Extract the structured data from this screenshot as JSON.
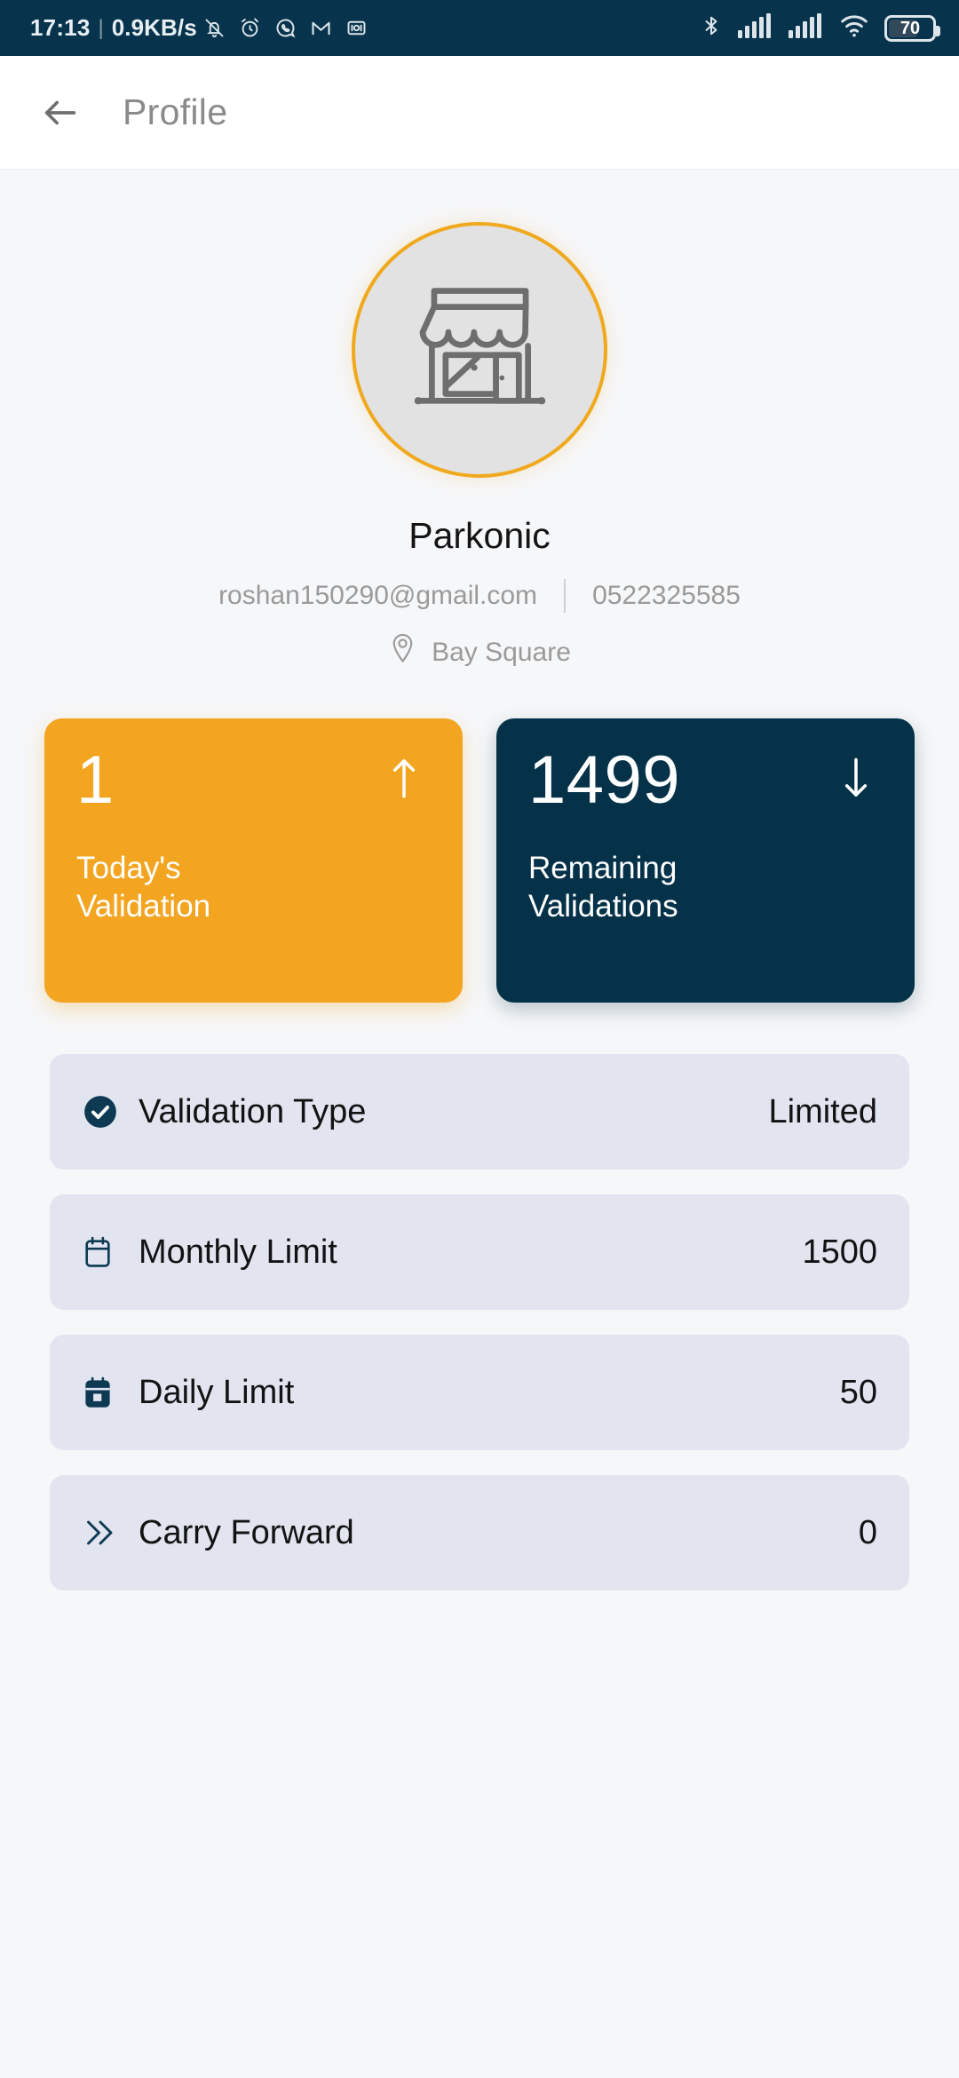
{
  "status_bar": {
    "time": "17:13",
    "separator": "|",
    "network_speed": "0.9KB/s",
    "left_icons": [
      "mute-bell-icon",
      "alarm-clock-icon",
      "whatsapp-icon",
      "gmail-icon",
      "screen-record-icon"
    ],
    "right_icons": [
      "bluetooth-icon",
      "signal-sim1-icon",
      "signal-sim2-icon",
      "wifi-icon"
    ],
    "battery_level": "70",
    "background_color": "#07344c"
  },
  "app_bar": {
    "back_label": "back-arrow",
    "title": "Profile"
  },
  "profile": {
    "avatar_icon": "storefront-icon",
    "avatar_border_color": "#f0a91d",
    "name": "Parkonic",
    "email": "roshan150290@gmail.com",
    "phone": "0522325585",
    "location_icon": "location-pin-icon",
    "location": "Bay Square"
  },
  "stat_cards": [
    {
      "value": "1",
      "label": "Today's\nValidation",
      "label_line1": "Today's",
      "label_line2": "Validation",
      "arrow": "arrow-up-icon",
      "background_color": "#f3a521"
    },
    {
      "value": "1499",
      "label": "Remaining\nValidations",
      "label_line1": "Remaining",
      "label_line2": "Validations",
      "arrow": "arrow-down-icon",
      "background_color": "#053248"
    }
  ],
  "info_rows": [
    {
      "icon": "check-circle-filled-icon",
      "label": "Validation Type",
      "value": "Limited"
    },
    {
      "icon": "calendar-month-icon",
      "label": "Monthly Limit",
      "value": "1500"
    },
    {
      "icon": "calendar-day-icon",
      "label": "Daily Limit",
      "value": "50"
    },
    {
      "icon": "double-chevron-right-icon",
      "label": "Carry Forward",
      "value": "0"
    }
  ],
  "colors": {
    "page_background": "#f6f7f9",
    "row_background": "#e2e4f0",
    "accent_orange": "#f3a521",
    "accent_navy": "#053248"
  }
}
